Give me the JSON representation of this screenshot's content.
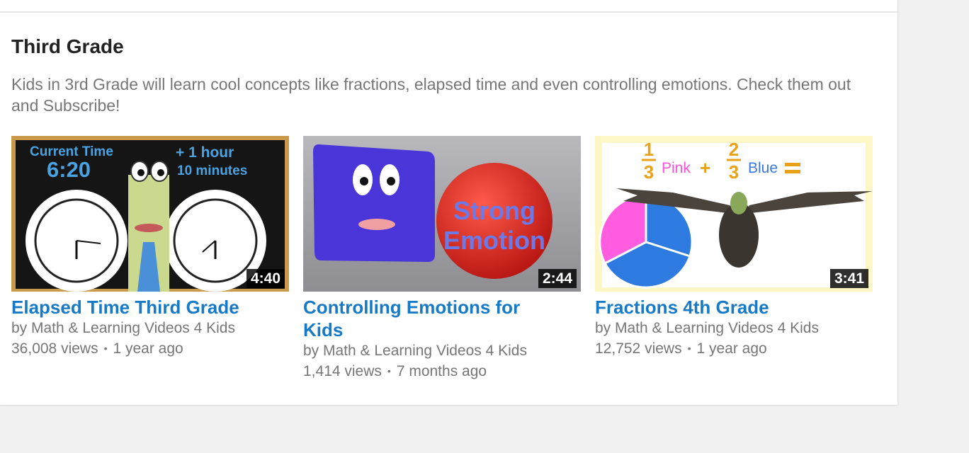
{
  "section": {
    "title": "Third Grade",
    "description": "Kids in 3rd Grade will learn cool concepts like fractions, elapsed time and even controlling emotions. Check them out and Subscribe!"
  },
  "videos": [
    {
      "title": "Elapsed Time Third Grade",
      "byline": "by Math & Learning Videos 4 Kids",
      "views": "36,008 views",
      "age": "1 year ago",
      "duration": "4:40",
      "thumb_text": {
        "current_time_label": "Current Time",
        "current_time": "6:20",
        "plus_hour": "+ 1 hour",
        "plus_minutes": "10 minutes"
      }
    },
    {
      "title": "Controlling Emotions for Kids",
      "byline": "by Math & Learning Videos 4 Kids",
      "views": "1,414 views",
      "age": "7 months ago",
      "duration": "2:44",
      "thumb_text": {
        "line1": "Strong",
        "line2": "Emotion"
      }
    },
    {
      "title": "Fractions 4th Grade",
      "byline": "by Math & Learning Videos 4 Kids",
      "views": "12,752 views",
      "age": "1 year ago",
      "duration": "3:41",
      "thumb_text": {
        "num1": "1",
        "den1": "3",
        "word1": "Pink",
        "num2": "2",
        "den2": "3",
        "word2": "Blue"
      }
    }
  ],
  "separator": "•",
  "colors": {
    "link": "#167ac6",
    "meta_text": "#767676",
    "title_text": "#222222"
  }
}
